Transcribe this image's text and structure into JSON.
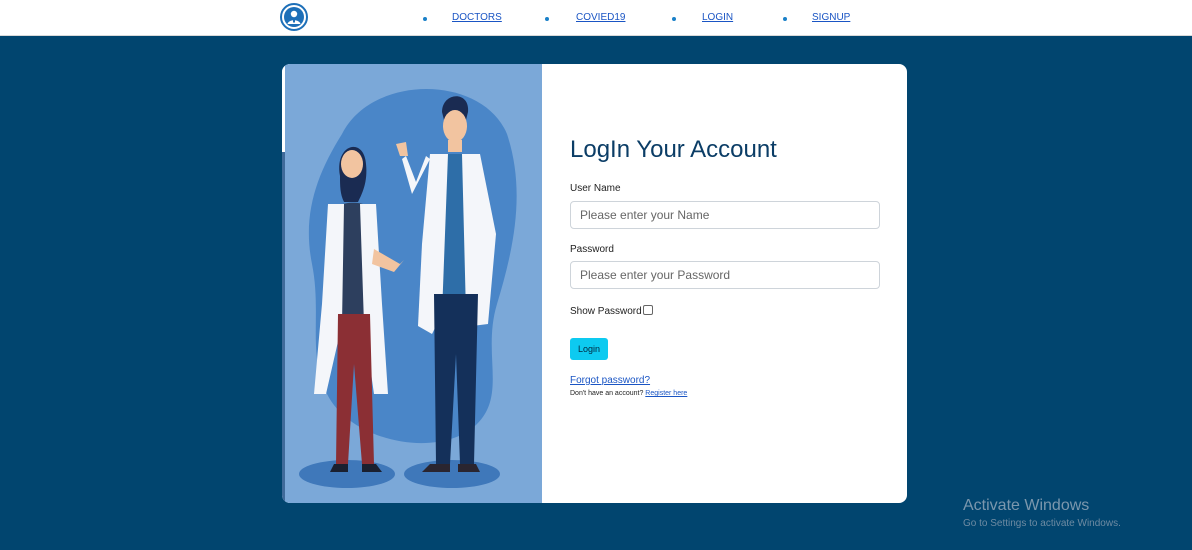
{
  "nav": {
    "items": [
      {
        "label": "DOCTORS"
      },
      {
        "label": "COVIED19"
      },
      {
        "label": "LOGIN"
      },
      {
        "label": "SIGNUP"
      }
    ]
  },
  "icons": {
    "logo": "doctor-avatar-icon",
    "bullet": "bullet-icon"
  },
  "form": {
    "title": "LogIn Your Account",
    "username_label": "User Name",
    "username_placeholder": "Please enter your Name",
    "username_value": "",
    "password_label": "Password",
    "password_placeholder": "Please enter your Password",
    "password_value": "",
    "show_password_label": "Show Password",
    "show_password_checked": false,
    "login_button": "Login",
    "forgot_password": "Forgot password?",
    "no_account_text": "Don't have an account?",
    "register_link": "Register here"
  },
  "watermark": {
    "title": "Activate Windows",
    "subtitle": "Go to Settings to activate Windows."
  },
  "colors": {
    "page_background": "#01456f",
    "illustration_background": "#7ba8d8",
    "button": "#0dcaf0",
    "link": "#1a55c4"
  }
}
